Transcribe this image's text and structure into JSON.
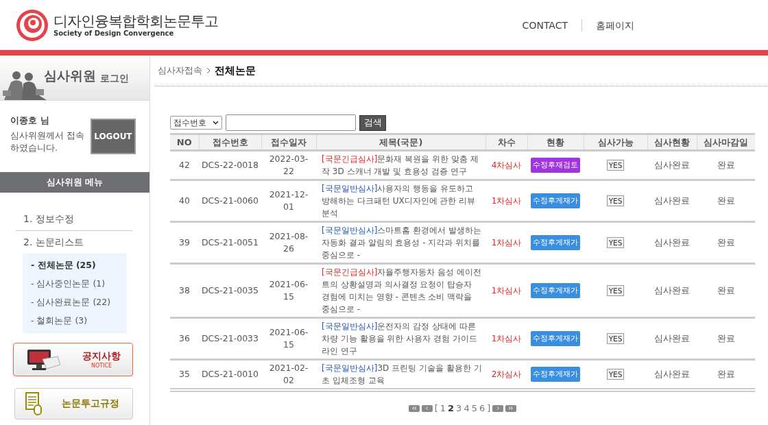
{
  "header": {
    "logo_title": "디자인융복합학회논문투고",
    "logo_subtitle": "Society of Design Convergence",
    "nav": [
      "CONTACT",
      "홈페이지"
    ]
  },
  "sidebar": {
    "login_title": "심사위원",
    "login_suffix": "로그인",
    "user_name": "이종호 님",
    "user_message": "심사위원께서 접속하였습니다.",
    "logout": "LOGOUT",
    "menu_title": "심사위원 메뉴",
    "menu": [
      {
        "label": "1. 정보수정"
      },
      {
        "label": "2. 논문리스트",
        "children": [
          {
            "label": "- 전체논문 (25)",
            "selected": true
          },
          {
            "label": "- 심사중인논문 (1)",
            "selected": false
          },
          {
            "label": "- 심사완료논문 (22)",
            "selected": false
          },
          {
            "label": "- 철회논문 (3)",
            "selected": false
          }
        ]
      }
    ],
    "notice": {
      "title": "공지사항",
      "subtitle": "NOTICE"
    },
    "rules": {
      "title": "논문투고규정"
    }
  },
  "breadcrumb": {
    "parent": "심사자접속",
    "current": "전체논문"
  },
  "search": {
    "select": "접수번호",
    "button": "검색"
  },
  "table": {
    "columns": [
      "NO",
      "접수번호",
      "접수일자",
      "제목(국문)",
      "차수",
      "현황",
      "심사가능",
      "심사현황",
      "심사마감일"
    ],
    "rows": [
      {
        "no": "42",
        "id": "DCS-22-0018",
        "date": "2022-03-22",
        "tag": {
          "label": "[국문긴급심사]",
          "kind": "urgent"
        },
        "title": "문화재 복원을 위한 맞춤 제작 3D 스캐너 개발 및 효용성 검증 연구",
        "round": "4차심사",
        "status": {
          "label": "수정후재검토",
          "color": "#a035e0"
        },
        "can_review": "YES",
        "review_status": "심사완료",
        "deadline": "완료"
      },
      {
        "no": "40",
        "id": "DCS-21-0060",
        "date": "2021-12-01",
        "tag": {
          "label": "[국문일반심사]",
          "kind": "general"
        },
        "title": "사용자의 행동을 유도하고 방해하는 다크패턴 UX디자인에 관한 리뷰 분석",
        "round": "1차심사",
        "status": {
          "label": "수정후게재가",
          "color": "#3a8ee0"
        },
        "can_review": "YES",
        "review_status": "심사완료",
        "deadline": "완료"
      },
      {
        "no": "39",
        "id": "DCS-21-0051",
        "date": "2021-08-26",
        "tag": {
          "label": "[국문일반심사]",
          "kind": "general"
        },
        "title": "스마트홈 환경에서 발생하는 자동화 결과 알림의 효용성 - 지각과 위치를 중심으로 -",
        "round": "1차심사",
        "status": {
          "label": "수정후게재가",
          "color": "#3a8ee0"
        },
        "can_review": "YES",
        "review_status": "심사완료",
        "deadline": "완료"
      },
      {
        "no": "38",
        "id": "DCS-21-0035",
        "date": "2021-06-15",
        "tag": {
          "label": "[국문긴급심사]",
          "kind": "urgent"
        },
        "title": "자율주행자동차 음성 에이전트의 상황설명과 의사결정 요청이 탑승자 경험에 미치는 영향 - 콘텐츠 소비 맥락을 중심으로 -",
        "round": "1차심사",
        "status": {
          "label": "수정후게재가",
          "color": "#3a8ee0"
        },
        "can_review": "YES",
        "review_status": "심사완료",
        "deadline": "완료"
      },
      {
        "no": "36",
        "id": "DCS-21-0033",
        "date": "2021-06-15",
        "tag": {
          "label": "[국문일반심사]",
          "kind": "general"
        },
        "title": "운전자의 감정 상태에 따른 차량 기능 활용을 위한 사용자 경험 가이드라인 연구",
        "round": "1차심사",
        "status": {
          "label": "수정후게재가",
          "color": "#3a8ee0"
        },
        "can_review": "YES",
        "review_status": "심사완료",
        "deadline": "완료"
      },
      {
        "no": "35",
        "id": "DCS-21-0010",
        "date": "2021-02-02",
        "tag": {
          "label": "[국문일반심사]",
          "kind": "general"
        },
        "title": "3D 프린팅 기술을 활용한 기초 입체조형 교육",
        "round": "2차심사",
        "status": {
          "label": "수정후게재가",
          "color": "#3a8ee0"
        },
        "can_review": "YES",
        "review_status": "심사완료",
        "deadline": "완료"
      }
    ]
  },
  "pagination": {
    "open": "[",
    "close": "]",
    "pages": [
      {
        "label": "1",
        "selected": false
      },
      {
        "label": "2",
        "selected": true
      },
      {
        "label": "3",
        "selected": false
      },
      {
        "label": "4",
        "selected": false
      },
      {
        "label": "5",
        "selected": false
      },
      {
        "label": "6",
        "selected": false
      }
    ]
  }
}
